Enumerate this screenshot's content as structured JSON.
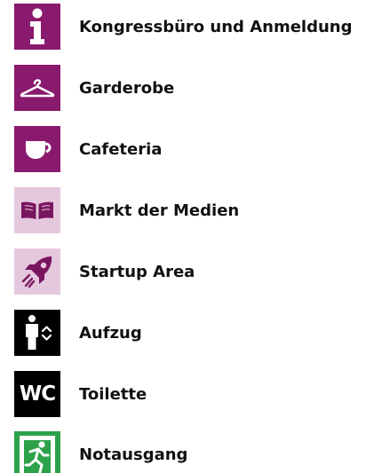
{
  "items": [
    {
      "label": "Kongressbüro und Anmeldung",
      "icon": "info-icon",
      "bg": "#8a1a6e"
    },
    {
      "label": "Garderobe",
      "icon": "coat-hanger-icon",
      "bg": "#8a1a6e"
    },
    {
      "label": "Cafeteria",
      "icon": "coffee-cup-icon",
      "bg": "#8a1a6e"
    },
    {
      "label": "Markt der Medien",
      "icon": "open-book-icon",
      "bg": "#e6c8de"
    },
    {
      "label": "Startup Area",
      "icon": "rocket-icon",
      "bg": "#e6c8de"
    },
    {
      "label": "Aufzug",
      "icon": "elevator-icon",
      "bg": "#000000"
    },
    {
      "label": "Toilette",
      "icon": "wc-icon",
      "bg": "#000000",
      "icon_text": "WC"
    },
    {
      "label": "Notausgang",
      "icon": "emergency-exit-icon",
      "bg": "#2ea24a"
    }
  ]
}
